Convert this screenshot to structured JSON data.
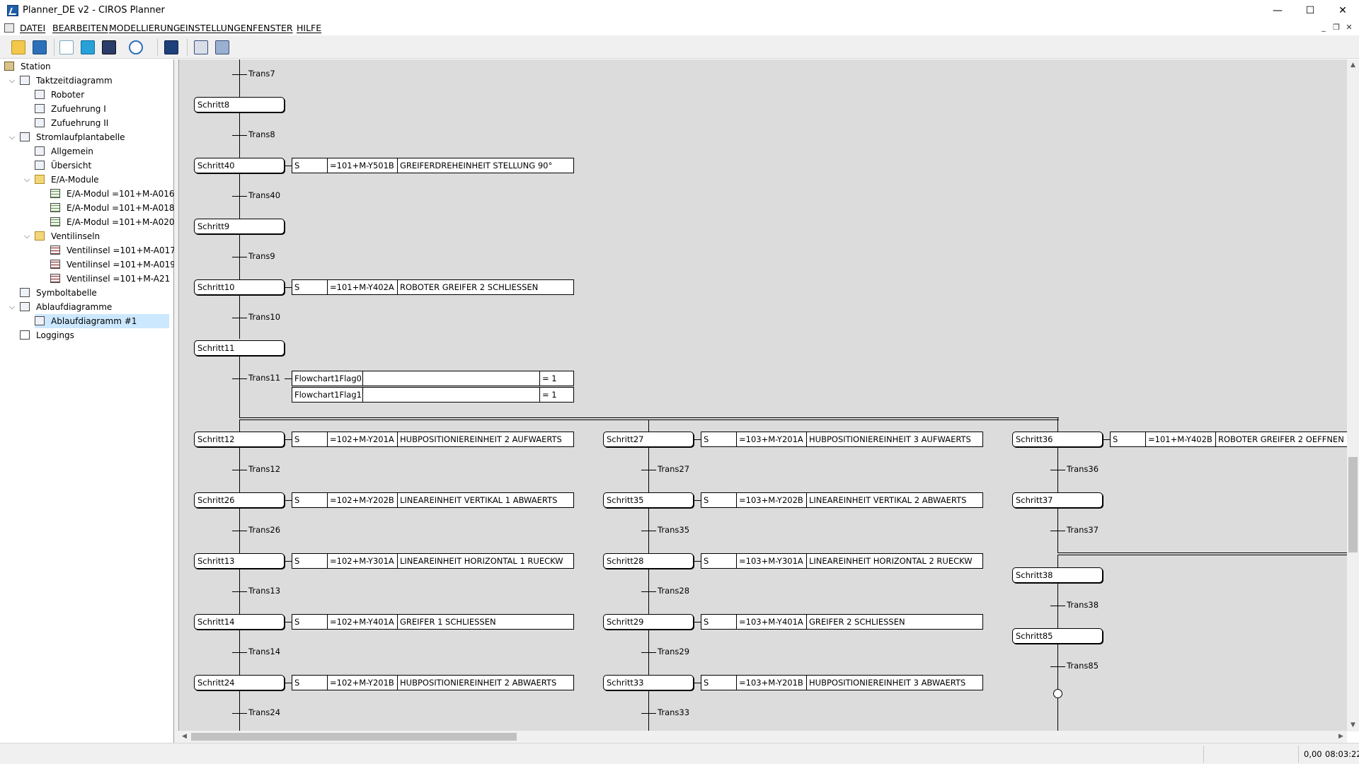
{
  "window": {
    "title": "Planner_DE v2 - CIROS Planner",
    "minimize": "—",
    "maximize": "☐",
    "close": "✕"
  },
  "menu": {
    "items": [
      "DATEI",
      "BEARBEITEN",
      "MODELLIERUNG",
      "EINSTELLUNGEN",
      "FENSTER",
      "HILFE"
    ],
    "mdi_min": "_",
    "mdi_restore": "❐",
    "mdi_close": "✕"
  },
  "toolbar": {
    "icons": [
      "open-icon",
      "save-icon",
      "cut-icon",
      "copy-icon",
      "paste-icon",
      "help-icon",
      "window-icon",
      "find-icon",
      "network-icon"
    ]
  },
  "tree": {
    "items": [
      {
        "label": "Station",
        "icon": "station-icon"
      },
      {
        "label": "Taktzeitdiagramm",
        "icon": "diagram-icon"
      },
      {
        "label": "Roboter",
        "icon": "diagram-icon"
      },
      {
        "label": "Zufuehrung I",
        "icon": "diagram-icon"
      },
      {
        "label": "Zufuehrung II",
        "icon": "diagram-icon"
      },
      {
        "label": "Stromlaufplantabelle",
        "icon": "diagram-icon"
      },
      {
        "label": "Allgemein",
        "icon": "diagram-icon"
      },
      {
        "label": "Übersicht",
        "icon": "diagram-icon"
      },
      {
        "label": "E/A-Module",
        "icon": "folder-icon"
      },
      {
        "label": "E/A-Modul =101+M-A016",
        "icon": "table-icon"
      },
      {
        "label": "E/A-Modul =101+M-A018",
        "icon": "table-icon"
      },
      {
        "label": "E/A-Modul =101+M-A020",
        "icon": "table-icon"
      },
      {
        "label": "Ventilinseln",
        "icon": "folder-icon"
      },
      {
        "label": "Ventilinsel =101+M-A017",
        "icon": "valve-table-icon"
      },
      {
        "label": "Ventilinsel =101+M-A019",
        "icon": "valve-table-icon"
      },
      {
        "label": "Ventilinsel =101+M-A21",
        "icon": "valve-table-icon"
      },
      {
        "label": "Symboltabelle",
        "icon": "diagram-icon"
      },
      {
        "label": "Ablaufdiagramme",
        "icon": "diagram-icon"
      },
      {
        "label": "Ablaufdiagramm #1",
        "icon": "diagram-icon"
      },
      {
        "label": "Loggings",
        "icon": "log-icon"
      }
    ]
  },
  "diagram": {
    "col1": {
      "steps": [
        "Schritt8",
        "Schritt40",
        "Schritt9",
        "Schritt10",
        "Schritt11",
        "Schritt12",
        "Schritt26",
        "Schritt13",
        "Schritt14",
        "Schritt24"
      ],
      "transitions": [
        "Trans7",
        "Trans8",
        "Trans40",
        "Trans9",
        "Trans10",
        "Trans11",
        "Trans12",
        "Trans26",
        "Trans13",
        "Trans14",
        "Trans24"
      ],
      "actions": [
        {
          "q": "S",
          "addr": "=101+M-Y501B",
          "text": "GREIFERDREHEINHEIT STELLUNG 90°"
        },
        {
          "q": "S",
          "addr": "=101+M-Y402A",
          "text": "ROBOTER GREIFER 2 SCHLIESSEN"
        },
        {
          "q": "S",
          "addr": "=102+M-Y201A",
          "text": "HUBPOSITIONIEREINHEIT 2 AUFWAERTS"
        },
        {
          "q": "S",
          "addr": "=102+M-Y202B",
          "text": "LINEAREINHEIT VERTIKAL 1 ABWAERTS"
        },
        {
          "q": "S",
          "addr": "=102+M-Y301A",
          "text": "LINEAREINHEIT HORIZONTAL 1 RUECKW"
        },
        {
          "q": "S",
          "addr": "=102+M-Y401A",
          "text": "GREIFER 1 SCHLIESSEN"
        },
        {
          "q": "S",
          "addr": "=102+M-Y201B",
          "text": "HUBPOSITIONIEREINHEIT 2 ABWAERTS"
        }
      ],
      "conditions": [
        {
          "flag": "Flowchart1Flag0",
          "value": "",
          "cmp": "= 1"
        },
        {
          "flag": "Flowchart1Flag1",
          "value": "",
          "cmp": "= 1"
        }
      ]
    },
    "col2": {
      "steps": [
        "Schritt27",
        "Schritt35",
        "Schritt28",
        "Schritt29",
        "Schritt33"
      ],
      "transitions": [
        "Trans27",
        "Trans35",
        "Trans28",
        "Trans29",
        "Trans33"
      ],
      "actions": [
        {
          "q": "S",
          "addr": "=103+M-Y201A",
          "text": "HUBPOSITIONIEREINHEIT 3 AUFWAERTS"
        },
        {
          "q": "S",
          "addr": "=103+M-Y202B",
          "text": "LINEAREINHEIT VERTIKAL 2 ABWAERTS"
        },
        {
          "q": "S",
          "addr": "=103+M-Y301A",
          "text": "LINEAREINHEIT HORIZONTAL 2 RUECKW"
        },
        {
          "q": "S",
          "addr": "=103+M-Y401A",
          "text": "GREIFER 2 SCHLIESSEN"
        },
        {
          "q": "S",
          "addr": "=103+M-Y201B",
          "text": "HUBPOSITIONIEREINHEIT 3 ABWAERTS"
        }
      ]
    },
    "col3": {
      "steps": [
        "Schritt36",
        "Schritt37",
        "Schritt38",
        "Schritt85"
      ],
      "transitions": [
        "Trans36",
        "Trans37",
        "Trans38",
        "Trans85"
      ],
      "actions": [
        {
          "q": "S",
          "addr": "=101+M-Y402B",
          "text": "ROBOTER GREIFER 2 OEFFNEN"
        }
      ]
    }
  },
  "status": {
    "value": "0,00",
    "time": "08:03:22"
  }
}
